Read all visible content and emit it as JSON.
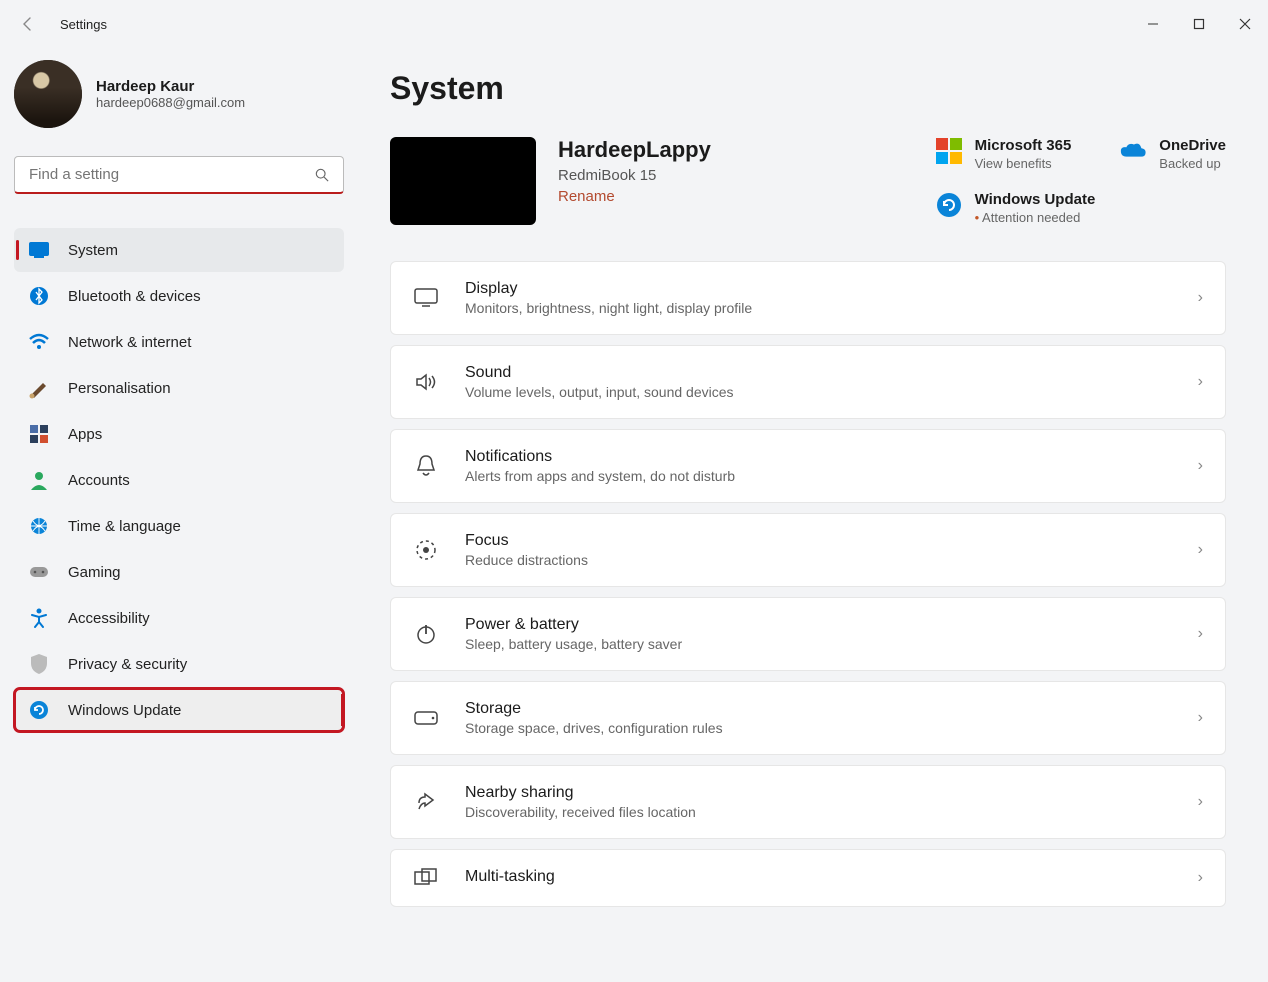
{
  "app": {
    "title": "Settings"
  },
  "user": {
    "name": "Hardeep Kaur",
    "email": "hardeep0688@gmail.com"
  },
  "search": {
    "placeholder": "Find a setting"
  },
  "sidebar": {
    "items": [
      {
        "label": "System"
      },
      {
        "label": "Bluetooth & devices"
      },
      {
        "label": "Network & internet"
      },
      {
        "label": "Personalisation"
      },
      {
        "label": "Apps"
      },
      {
        "label": "Accounts"
      },
      {
        "label": "Time & language"
      },
      {
        "label": "Gaming"
      },
      {
        "label": "Accessibility"
      },
      {
        "label": "Privacy & security"
      },
      {
        "label": "Windows Update"
      }
    ]
  },
  "page": {
    "title": "System"
  },
  "device": {
    "name": "HardeepLappy",
    "model": "RedmiBook 15",
    "rename": "Rename"
  },
  "status": {
    "m365": {
      "title": "Microsoft 365",
      "sub": "View benefits"
    },
    "onedrive": {
      "title": "OneDrive",
      "sub": "Backed up"
    },
    "update": {
      "title": "Windows Update",
      "sub": "Attention needed"
    }
  },
  "settings": [
    {
      "title": "Display",
      "sub": "Monitors, brightness, night light, display profile"
    },
    {
      "title": "Sound",
      "sub": "Volume levels, output, input, sound devices"
    },
    {
      "title": "Notifications",
      "sub": "Alerts from apps and system, do not disturb"
    },
    {
      "title": "Focus",
      "sub": "Reduce distractions"
    },
    {
      "title": "Power & battery",
      "sub": "Sleep, battery usage, battery saver"
    },
    {
      "title": "Storage",
      "sub": "Storage space, drives, configuration rules"
    },
    {
      "title": "Nearby sharing",
      "sub": "Discoverability, received files location"
    },
    {
      "title": "Multi-tasking",
      "sub": ""
    }
  ]
}
